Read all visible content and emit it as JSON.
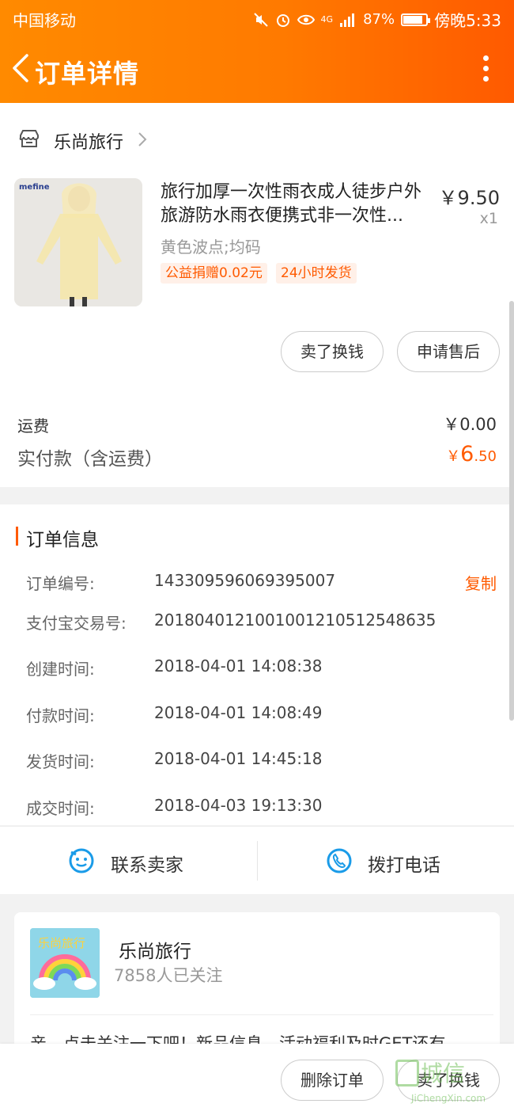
{
  "status_bar": {
    "carrier": "中国移动",
    "network": "4G",
    "battery": "87%",
    "battery_level": 0.87,
    "time": "傍晚5:33"
  },
  "header": {
    "title": "订单详情"
  },
  "store": {
    "name": "乐尚旅行"
  },
  "product": {
    "title": "旅行加厚一次性雨衣成人徒步户外旅游防水雨衣便携式非一次性...",
    "price": "￥9.50",
    "qty": "x1",
    "sku": "黄色波点;均码",
    "tags": [
      "公益捐赠0.02元",
      "24小时发货"
    ],
    "thumb_brand": "mefine"
  },
  "actions": {
    "sell_label": "卖了换钱",
    "after_sale_label": "申请售后"
  },
  "fees": {
    "shipping_label": "运费",
    "shipping_value": "￥0.00",
    "paid_label": "实付款（含运费）",
    "paid_currency": "￥",
    "paid_int": "6",
    "paid_dec": ".50"
  },
  "order_info": {
    "section_title": "订单信息",
    "copy_label": "复制",
    "rows": [
      {
        "label": "订单编号:",
        "value": "143309596069395007"
      },
      {
        "label": "支付宝交易号:",
        "value": "2018040121001001210512548635"
      },
      {
        "label": "创建时间:",
        "value": "2018-04-01 14:08:38"
      },
      {
        "label": "付款时间:",
        "value": "2018-04-01 14:08:49"
      },
      {
        "label": "发货时间:",
        "value": "2018-04-01 14:45:18"
      },
      {
        "label": "成交时间:",
        "value": "2018-04-03 19:13:30"
      }
    ]
  },
  "contact": {
    "seller_label": "联系卖家",
    "phone_label": "拨打电话"
  },
  "shop_card": {
    "name": "乐尚旅行",
    "followers": "7858人已关注",
    "message": "亲，点击关注一下吧！新品信息，活动福利及时GET还有",
    "logo_text": "乐尚旅行"
  },
  "bottom_bar": {
    "delete_label": "删除订单",
    "sell_label": "卖了换钱"
  },
  "watermark": {
    "text": "城信",
    "url": "JiChengXin.com"
  },
  "colors": {
    "accent": "#ff5a00",
    "header_start": "#ff8a00",
    "header_end": "#ff5a00",
    "icon_blue": "#1a9be8"
  }
}
